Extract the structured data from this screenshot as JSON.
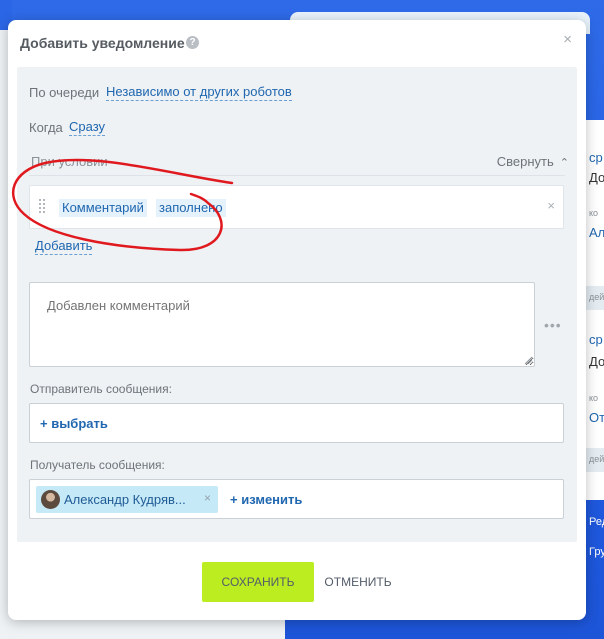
{
  "modal": {
    "title": "Добавить уведомление",
    "help_icon": "?",
    "close_icon": "×"
  },
  "settings": {
    "queue_label": "По очереди",
    "queue_value": "Независимо от других роботов",
    "when_label": "Когда",
    "when_value": "Сразу"
  },
  "conditions": {
    "header": "При условии",
    "collapse_label": "Свернуть",
    "field": "Комментарий",
    "operator": "заполнено",
    "remove_icon": "×",
    "add_label": "Добавить"
  },
  "message": {
    "placeholder": "Добавлен комментарий",
    "more_icon": "•••"
  },
  "sender": {
    "label": "Отправитель сообщения:",
    "choose_label": "+ выбрать"
  },
  "recipient": {
    "label": "Получатель сообщения:",
    "user_name": "Александр Кудряв...",
    "remove_icon": "×",
    "change_label": "+ изменить"
  },
  "buttons": {
    "save": "СОХРАНИТЬ",
    "cancel": "ОТМЕНИТЬ"
  },
  "background": {
    "snippets": [
      "ср",
      "До",
      "ко",
      "Ал",
      "дей",
      "ср",
      "До",
      "ко",
      "От",
      "дей",
      "Ред",
      "Гру"
    ]
  },
  "colors": {
    "accent_link": "#2067b0",
    "save_button": "#bbed21",
    "annotation": "#e0191f",
    "panel_bg": "#eef2f4",
    "page_bg": "#2f6be8"
  }
}
